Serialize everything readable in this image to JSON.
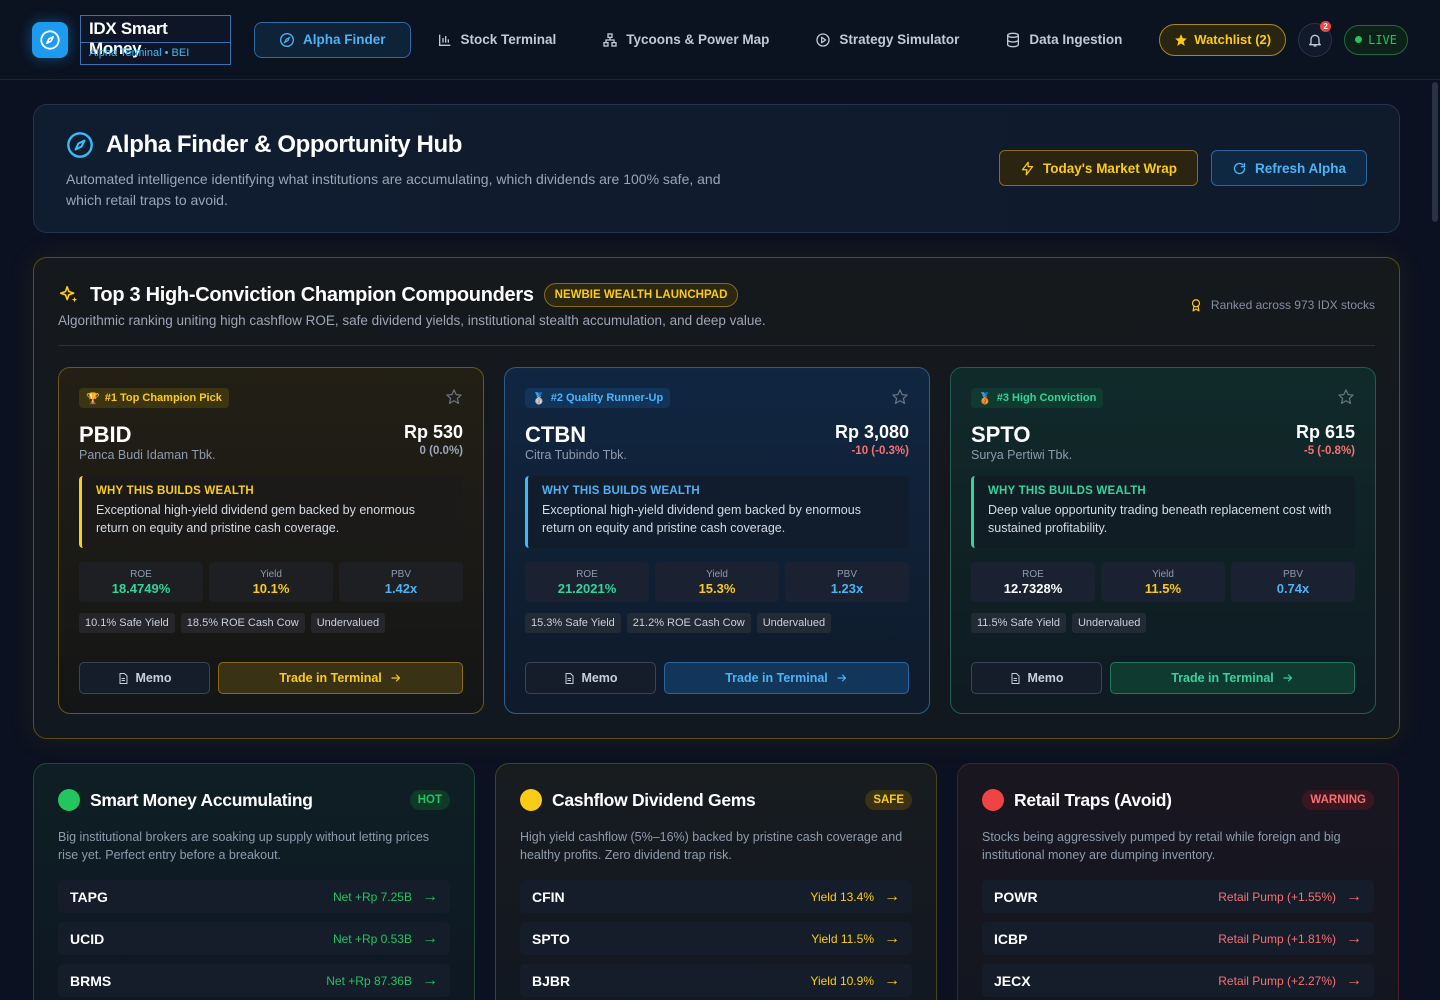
{
  "brand": {
    "title": "IDX Smart Money",
    "subtitle": "Alpha Terminal • BEI"
  },
  "nav": {
    "items": [
      {
        "label": "Alpha Finder"
      },
      {
        "label": "Stock Terminal"
      },
      {
        "label": "Tycoons & Power Map"
      },
      {
        "label": "Strategy Simulator"
      },
      {
        "label": "Data Ingestion"
      }
    ],
    "watchlist": "Watchlist (2)",
    "notifications": "2",
    "live": "LIVE"
  },
  "hero": {
    "title": "Alpha Finder & Opportunity Hub",
    "description": "Automated intelligence identifying what institutions are accumulating, which dividends are 100% safe, and which retail traps to avoid.",
    "wrap_button": "Today's Market Wrap",
    "refresh_button": "Refresh Alpha"
  },
  "champions": {
    "title": "Top 3 High-Conviction Champion Compounders",
    "badge": "NEWBIE WEALTH LAUNCHPAD",
    "description": "Algorithmic ranking uniting high cashflow ROE, safe dividend yields, institutional stealth accumulation, and deep value.",
    "ranked": "Ranked across 973 IDX stocks",
    "why_label": "WHY THIS BUILDS WEALTH",
    "memo_label": "Memo",
    "trade_label": "Trade in Terminal",
    "metric_labels": {
      "roe": "ROE",
      "yield": "Yield",
      "pbv": "PBV"
    },
    "cards": [
      {
        "rank": "#1 Top Champion Pick",
        "ticker": "PBID",
        "company": "Panca Budi Idaman Tbk.",
        "price": "Rp 530",
        "change": "0 (0.0%)",
        "change_color": "#9aa6b8",
        "why": "Exceptional high-yield dividend gem backed by enormous return on equity and pristine cash coverage.",
        "roe": "18.4749%",
        "yield": "10.1%",
        "pbv": "1.42x",
        "tags": [
          "10.1% Safe Yield",
          "18.5% ROE Cash Cow",
          "Undervalued"
        ]
      },
      {
        "rank": "#2 Quality Runner-Up",
        "ticker": "CTBN",
        "company": "Citra Tubindo Tbk.",
        "price": "Rp 3,080",
        "change": "-10 (-0.3%)",
        "change_color": "#f87171",
        "why": "Exceptional high-yield dividend gem backed by enormous return on equity and pristine cash coverage.",
        "roe": "21.2021%",
        "yield": "15.3%",
        "pbv": "1.23x",
        "tags": [
          "15.3% Safe Yield",
          "21.2% ROE Cash Cow",
          "Undervalued"
        ]
      },
      {
        "rank": "#3 High Conviction",
        "ticker": "SPTO",
        "company": "Surya Pertiwi Tbk.",
        "price": "Rp 615",
        "change": "-5 (-0.8%)",
        "change_color": "#f87171",
        "why": "Deep value opportunity trading beneath replacement cost with sustained profitability.",
        "roe": "12.7328%",
        "yield": "11.5%",
        "pbv": "0.74x",
        "tags": [
          "11.5% Safe Yield",
          "Undervalued"
        ]
      }
    ]
  },
  "panels": [
    {
      "title": "Smart Money Accumulating",
      "badge": "HOT",
      "description": "Big institutional brokers are soaking up supply without letting prices rise yet. Perfect entry before a breakout.",
      "rows": [
        {
          "ticker": "TAPG",
          "value": "Net +Rp 7.25B"
        },
        {
          "ticker": "UCID",
          "value": "Net +Rp 0.53B"
        },
        {
          "ticker": "BRMS",
          "value": "Net +Rp 87.36B"
        }
      ]
    },
    {
      "title": "Cashflow Dividend Gems",
      "badge": "SAFE",
      "description": "High yield cashflow (5%–16%) backed by pristine cash coverage and healthy profits. Zero dividend trap risk.",
      "rows": [
        {
          "ticker": "CFIN",
          "value": "Yield 13.4%"
        },
        {
          "ticker": "SPTO",
          "value": "Yield 11.5%"
        },
        {
          "ticker": "BJBR",
          "value": "Yield 10.9%"
        }
      ]
    },
    {
      "title": "Retail Traps (Avoid)",
      "badge": "WARNING",
      "description": "Stocks being aggressively pumped by retail while foreign and big institutional money are dumping inventory.",
      "rows": [
        {
          "ticker": "POWR",
          "value": "Retail Pump (+1.55%)"
        },
        {
          "ticker": "ICBP",
          "value": "Retail Pump (+1.81%)"
        },
        {
          "ticker": "JECX",
          "value": "Retail Pump (+2.27%)"
        }
      ]
    }
  ],
  "colors": {
    "accent_blue": "#1d9bf0",
    "gold": "#facc15",
    "green": "#22c55e",
    "teal": "#34d399",
    "red": "#f87171"
  },
  "icons": [
    "compass-icon",
    "chart-icon",
    "network-icon",
    "play-circle-icon",
    "database-icon",
    "star-icon",
    "bell-icon",
    "bolt-icon",
    "refresh-icon",
    "sparkles-icon",
    "award-icon",
    "trophy-icon",
    "medal-icon",
    "document-icon",
    "arrow-right-icon"
  ]
}
